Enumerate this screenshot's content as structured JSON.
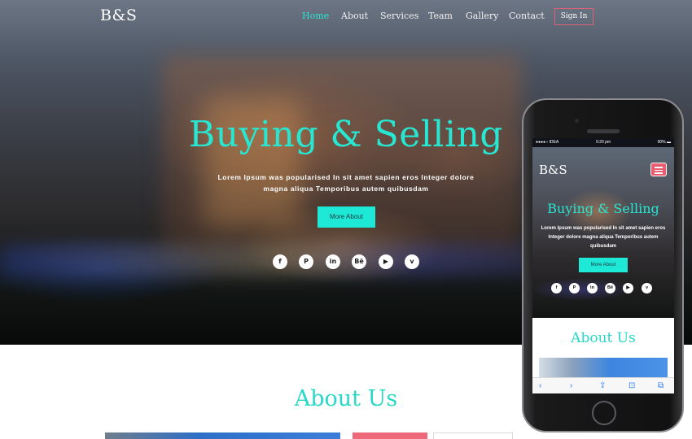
{
  "header": {
    "logo": "B&S",
    "nav": [
      {
        "label": "Home",
        "active": true
      },
      {
        "label": "About",
        "active": false
      },
      {
        "label": "Services",
        "active": false
      },
      {
        "label": "Team",
        "active": false
      },
      {
        "label": "Gallery",
        "active": false
      },
      {
        "label": "Contact",
        "active": false
      }
    ],
    "signin_label": "Sign In"
  },
  "hero": {
    "title": "Buying & Selling",
    "text_line1": "Lorem Ipsum was popularised In sit amet sapien eros Integer dolore",
    "text_line2": "magna aliqua Temporibus autem quibusdam",
    "button_label": "More About",
    "social": [
      {
        "icon": "facebook-icon",
        "glyph": "f"
      },
      {
        "icon": "pinterest-icon",
        "glyph": "P"
      },
      {
        "icon": "linkedin-icon",
        "glyph": "in"
      },
      {
        "icon": "behance-icon",
        "glyph": "Bē"
      },
      {
        "icon": "youtube-icon",
        "glyph": "▶"
      },
      {
        "icon": "vimeo-icon",
        "glyph": "v"
      }
    ]
  },
  "about": {
    "title": "About Us"
  },
  "phone": {
    "status_left": "●●●●○ IDEA ",
    "status_time": "9:20 pm",
    "status_right": "90% ▬",
    "logo": "B&S",
    "title": "Buying & Selling",
    "text": "Lorem Ipsum was popularised In sit amet sapien eros Integer dolore magna aliqua Temporibus autem quibusdam",
    "button_label": "More About",
    "about_title": "About Us",
    "toolbar": [
      "‹",
      "›",
      "⇪",
      "⊡",
      "⧉"
    ]
  },
  "colors": {
    "accent": "#27e6d2",
    "button": "#1ee8d6",
    "signin_border": "#e0607a",
    "menu_button": "#e95d70"
  }
}
